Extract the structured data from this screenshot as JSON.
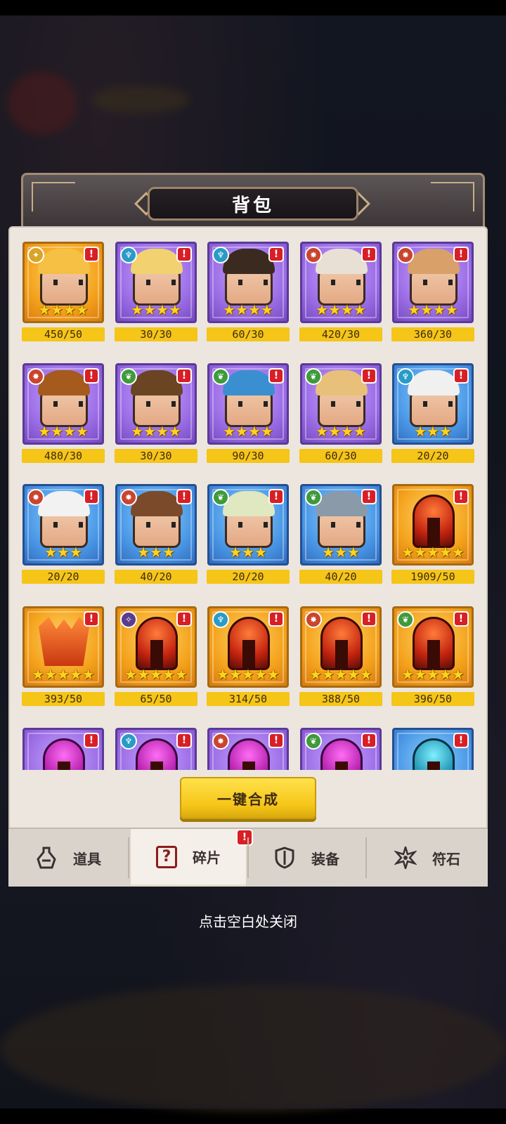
{
  "title": "背包",
  "cards": [
    {
      "row": 0,
      "col": 0,
      "rarity": "gold",
      "art": "hero",
      "hair": "#f5c043",
      "faction": "light",
      "faction_icon": "light-faction-icon",
      "stars": "★★★★",
      "count": "450/50"
    },
    {
      "row": 0,
      "col": 1,
      "rarity": "purple",
      "art": "hero",
      "hair": "#f2d170",
      "faction": "water",
      "faction_icon": "water-faction-icon",
      "stars": "★★★★",
      "count": "30/30"
    },
    {
      "row": 0,
      "col": 2,
      "rarity": "purple",
      "art": "hero",
      "hair": "#3b2a20",
      "faction": "water",
      "faction_icon": "water-faction-icon",
      "stars": "★★★★",
      "count": "60/30"
    },
    {
      "row": 0,
      "col": 3,
      "rarity": "purple",
      "art": "hero",
      "hair": "#e8e0d4",
      "faction": "fire",
      "faction_icon": "fire-faction-icon",
      "stars": "★★★★",
      "count": "420/30"
    },
    {
      "row": 0,
      "col": 4,
      "rarity": "purple",
      "art": "hero",
      "hair": "#d9a06a",
      "faction": "fire",
      "faction_icon": "fire-faction-icon",
      "stars": "★★★★",
      "count": "360/30"
    },
    {
      "row": 1,
      "col": 0,
      "rarity": "purple",
      "art": "hero",
      "hair": "#a65a1e",
      "faction": "fire",
      "faction_icon": "fire-faction-icon",
      "stars": "★★★★",
      "count": "480/30"
    },
    {
      "row": 1,
      "col": 1,
      "rarity": "purple",
      "art": "hero",
      "hair": "#6b4423",
      "faction": "nature",
      "faction_icon": "nature-faction-icon",
      "stars": "★★★★",
      "count": "30/30"
    },
    {
      "row": 1,
      "col": 2,
      "rarity": "purple",
      "art": "hero",
      "hair": "#3a8fd0",
      "faction": "nature",
      "faction_icon": "nature-faction-icon",
      "stars": "★★★★",
      "count": "90/30"
    },
    {
      "row": 1,
      "col": 3,
      "rarity": "purple",
      "art": "hero",
      "hair": "#e9c07a",
      "faction": "nature",
      "faction_icon": "nature-faction-icon",
      "stars": "★★★★",
      "count": "60/30"
    },
    {
      "row": 1,
      "col": 4,
      "rarity": "blue",
      "art": "hero",
      "hair": "#f0f0f0",
      "faction": "water",
      "faction_icon": "water-faction-icon",
      "stars": "★★★",
      "count": "20/20"
    },
    {
      "row": 2,
      "col": 0,
      "rarity": "blue",
      "art": "hero",
      "hair": "#f2f2f2",
      "faction": "fire",
      "faction_icon": "fire-faction-icon",
      "stars": "★★★",
      "count": "20/20"
    },
    {
      "row": 2,
      "col": 1,
      "rarity": "blue",
      "art": "hero",
      "hair": "#7a4a2a",
      "faction": "fire",
      "faction_icon": "fire-faction-icon",
      "stars": "★★★",
      "count": "40/20"
    },
    {
      "row": 2,
      "col": 2,
      "rarity": "blue",
      "art": "hero",
      "hair": "#dfe8c0",
      "faction": "nature",
      "faction_icon": "nature-faction-icon",
      "stars": "★★★",
      "count": "20/20"
    },
    {
      "row": 2,
      "col": 3,
      "rarity": "blue",
      "art": "hero",
      "hair": "#8a9aa8",
      "faction": "nature",
      "faction_icon": "nature-faction-icon",
      "stars": "★★★",
      "count": "40/20"
    },
    {
      "row": 2,
      "col": 4,
      "rarity": "gold",
      "art": "helmet",
      "faction": "",
      "faction_icon": "",
      "stars": "★★★★★",
      "count": "1909/50"
    },
    {
      "row": 3,
      "col": 0,
      "rarity": "gold",
      "art": "crown",
      "faction": "",
      "faction_icon": "",
      "stars": "★★★★★",
      "count": "393/50"
    },
    {
      "row": 3,
      "col": 1,
      "rarity": "gold",
      "art": "helmet",
      "faction": "dark",
      "faction_icon": "dark-faction-icon",
      "stars": "★★★★★",
      "count": "65/50"
    },
    {
      "row": 3,
      "col": 2,
      "rarity": "gold",
      "art": "helmet",
      "faction": "water",
      "faction_icon": "water-faction-icon",
      "stars": "★★★★★",
      "count": "314/50"
    },
    {
      "row": 3,
      "col": 3,
      "rarity": "gold",
      "art": "helmet",
      "faction": "fire",
      "faction_icon": "fire-faction-icon",
      "stars": "★★★★★",
      "count": "388/50"
    },
    {
      "row": 3,
      "col": 4,
      "rarity": "gold",
      "art": "helmet",
      "faction": "nature",
      "faction_icon": "nature-faction-icon",
      "stars": "★★★★★",
      "count": "396/50"
    },
    {
      "row": 4,
      "col": 0,
      "rarity": "purple",
      "art": "helmet-violet",
      "faction": "",
      "faction_icon": "",
      "stars": "",
      "count": ""
    },
    {
      "row": 4,
      "col": 1,
      "rarity": "purple",
      "art": "helmet-violet",
      "faction": "water",
      "faction_icon": "water-faction-icon",
      "stars": "",
      "count": ""
    },
    {
      "row": 4,
      "col": 2,
      "rarity": "purple",
      "art": "helmet-violet",
      "faction": "fire",
      "faction_icon": "fire-faction-icon",
      "stars": "",
      "count": ""
    },
    {
      "row": 4,
      "col": 3,
      "rarity": "purple",
      "art": "helmet-violet",
      "faction": "nature",
      "faction_icon": "nature-faction-icon",
      "stars": "",
      "count": ""
    },
    {
      "row": 4,
      "col": 4,
      "rarity": "blue",
      "art": "helmet-teal",
      "faction": "",
      "faction_icon": "",
      "stars": "",
      "count": ""
    }
  ],
  "alert_mark": "!",
  "merge_button": "一键合成",
  "tabs": [
    {
      "label": "道具",
      "icon": "potion-icon"
    },
    {
      "label": "碎片",
      "icon": "question-box-icon",
      "active": true
    },
    {
      "label": "装备",
      "icon": "shield-icon"
    },
    {
      "label": "符石",
      "icon": "rune-star-icon"
    }
  ],
  "close_hint": "点击空白处关闭",
  "colors": {
    "accent_yellow": "#f5c518",
    "alert_red": "#d81f26",
    "panel": "#ece6df"
  }
}
